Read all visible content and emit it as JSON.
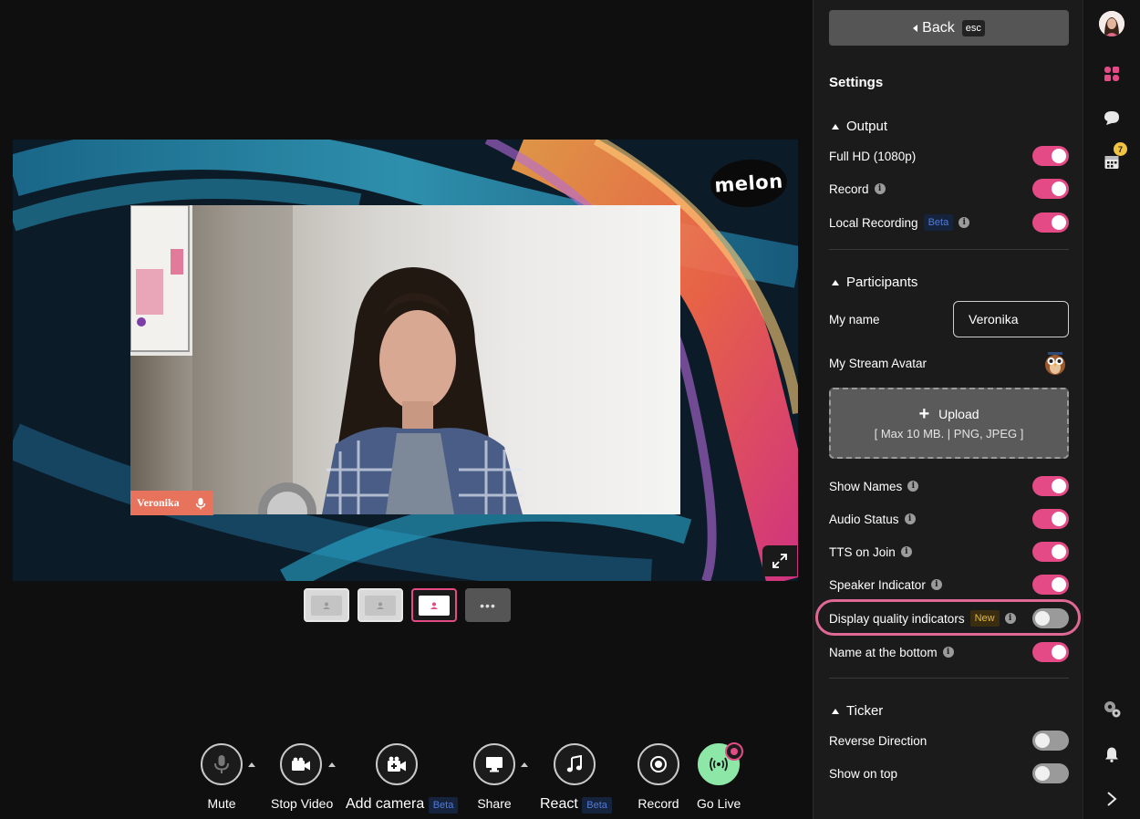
{
  "stage": {
    "brand": "melon",
    "participant_name": "Veronika"
  },
  "toolbar": {
    "mute": "Mute",
    "stop_video": "Stop Video",
    "add_camera": "Add camera",
    "add_camera_badge": "Beta",
    "share": "Share",
    "react": "React",
    "react_badge": "Beta",
    "record": "Record",
    "go_live": "Go Live"
  },
  "settings": {
    "back_label": "Back",
    "back_key": "esc",
    "title": "Settings",
    "output": {
      "heading": "Output",
      "full_hd": "Full HD (1080p)",
      "record": "Record",
      "local_recording": "Local Recording",
      "local_recording_badge": "Beta"
    },
    "participants": {
      "heading": "Participants",
      "my_name_label": "My name",
      "my_name_value": "Veronika",
      "stream_avatar": "My Stream Avatar",
      "upload_label": "Upload",
      "upload_hint": "[ Max 10 MB. | PNG, JPEG ]",
      "show_names": "Show Names",
      "audio_status": "Audio Status",
      "tts_on_join": "TTS on Join",
      "speaker_indicator": "Speaker Indicator",
      "display_quality": "Display quality indicators",
      "display_quality_badge": "New",
      "name_bottom": "Name at the bottom"
    },
    "ticker": {
      "heading": "Ticker",
      "reverse_direction": "Reverse Direction",
      "show_on_top": "Show on top"
    }
  },
  "rail": {
    "calendar_badge": "7"
  },
  "colors": {
    "accent": "#e44a86",
    "panel_bg": "#1b1b1b",
    "go_live": "#8de8a7"
  }
}
